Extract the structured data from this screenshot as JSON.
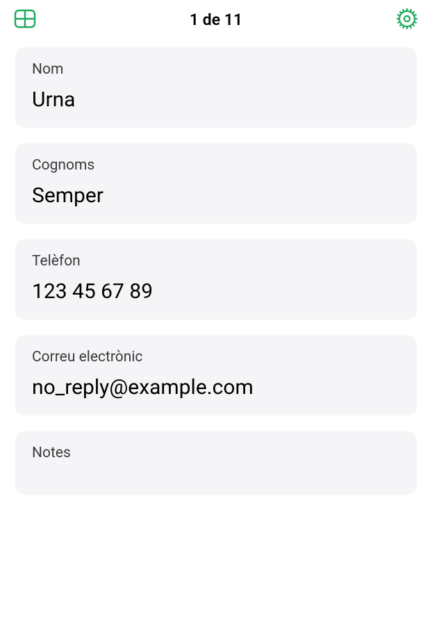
{
  "header": {
    "title": "1 de 11"
  },
  "icons": {
    "grid": "grid-icon",
    "gear": "gear-icon"
  },
  "colors": {
    "accent": "#1aaa5d",
    "cardBg": "#f5f5f7"
  },
  "fields": {
    "name": {
      "label": "Nom",
      "value": "Urna"
    },
    "surname": {
      "label": "Cognoms",
      "value": "Semper"
    },
    "phone": {
      "label": "Telèfon",
      "value": "123 45 67 89"
    },
    "email": {
      "label": "Correu electrònic",
      "value": "no_reply@example.com"
    },
    "notes": {
      "label": "Notes",
      "value": ""
    }
  }
}
